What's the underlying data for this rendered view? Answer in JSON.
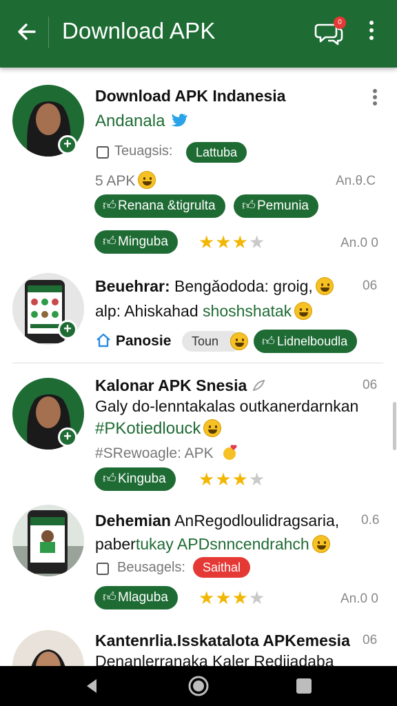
{
  "appbar": {
    "title": "Download APK",
    "chat_badge": "0"
  },
  "colors": {
    "primary": "#1e6b34",
    "star": "#f2b705",
    "alert": "#e53935"
  },
  "items": [
    {
      "title": "Download APK Indanesia",
      "subtitle": "Andanala",
      "checkbox_label": "Teuagsis:",
      "chip": "Lattuba",
      "apk_label": "5 APK",
      "meta_right": "An.θ.C",
      "tag_1": "Renana &tigrulta",
      "tag_2": "Pemunia",
      "tag_3": "Minguba",
      "rating": 3,
      "meta_bottom": "An.0 0"
    },
    {
      "title_bold": "Beuehrar:",
      "title_rest": "Bengǎododa: groig,",
      "meta": "06",
      "line2_a": "alp:",
      "line2_b": "Ahiskahad",
      "line2_green": "shoshshatak",
      "home_label": "Panosie",
      "chip_light": "Toun",
      "tag": "Lidnelboudla"
    },
    {
      "title": "Kalonar APK Snesia",
      "meta": "06",
      "line2": "Galy do-lenntakalas outkanerdarnkan",
      "hashtag": "#PKotiedlouck",
      "line4": "#SRewoagle: APK",
      "tag": "Kinguba",
      "rating": 3
    },
    {
      "title_bold": "Dehemian",
      "title_rest": "AnRegodloulidragsaria,",
      "meta": "0.6",
      "line2_a": "paber",
      "line2_green": "tukay APDsnncendrahch",
      "checkbox_label": "Beusagels:",
      "chip_red": "Saithal",
      "tag": "Mlaguba",
      "rating": 3,
      "meta_bottom": "An.0 0"
    },
    {
      "title": "Kantenrlia.Isskatalota APKemesia",
      "meta": "06",
      "line2": "Denanlerranaka Kaler Rediiadaba"
    }
  ]
}
